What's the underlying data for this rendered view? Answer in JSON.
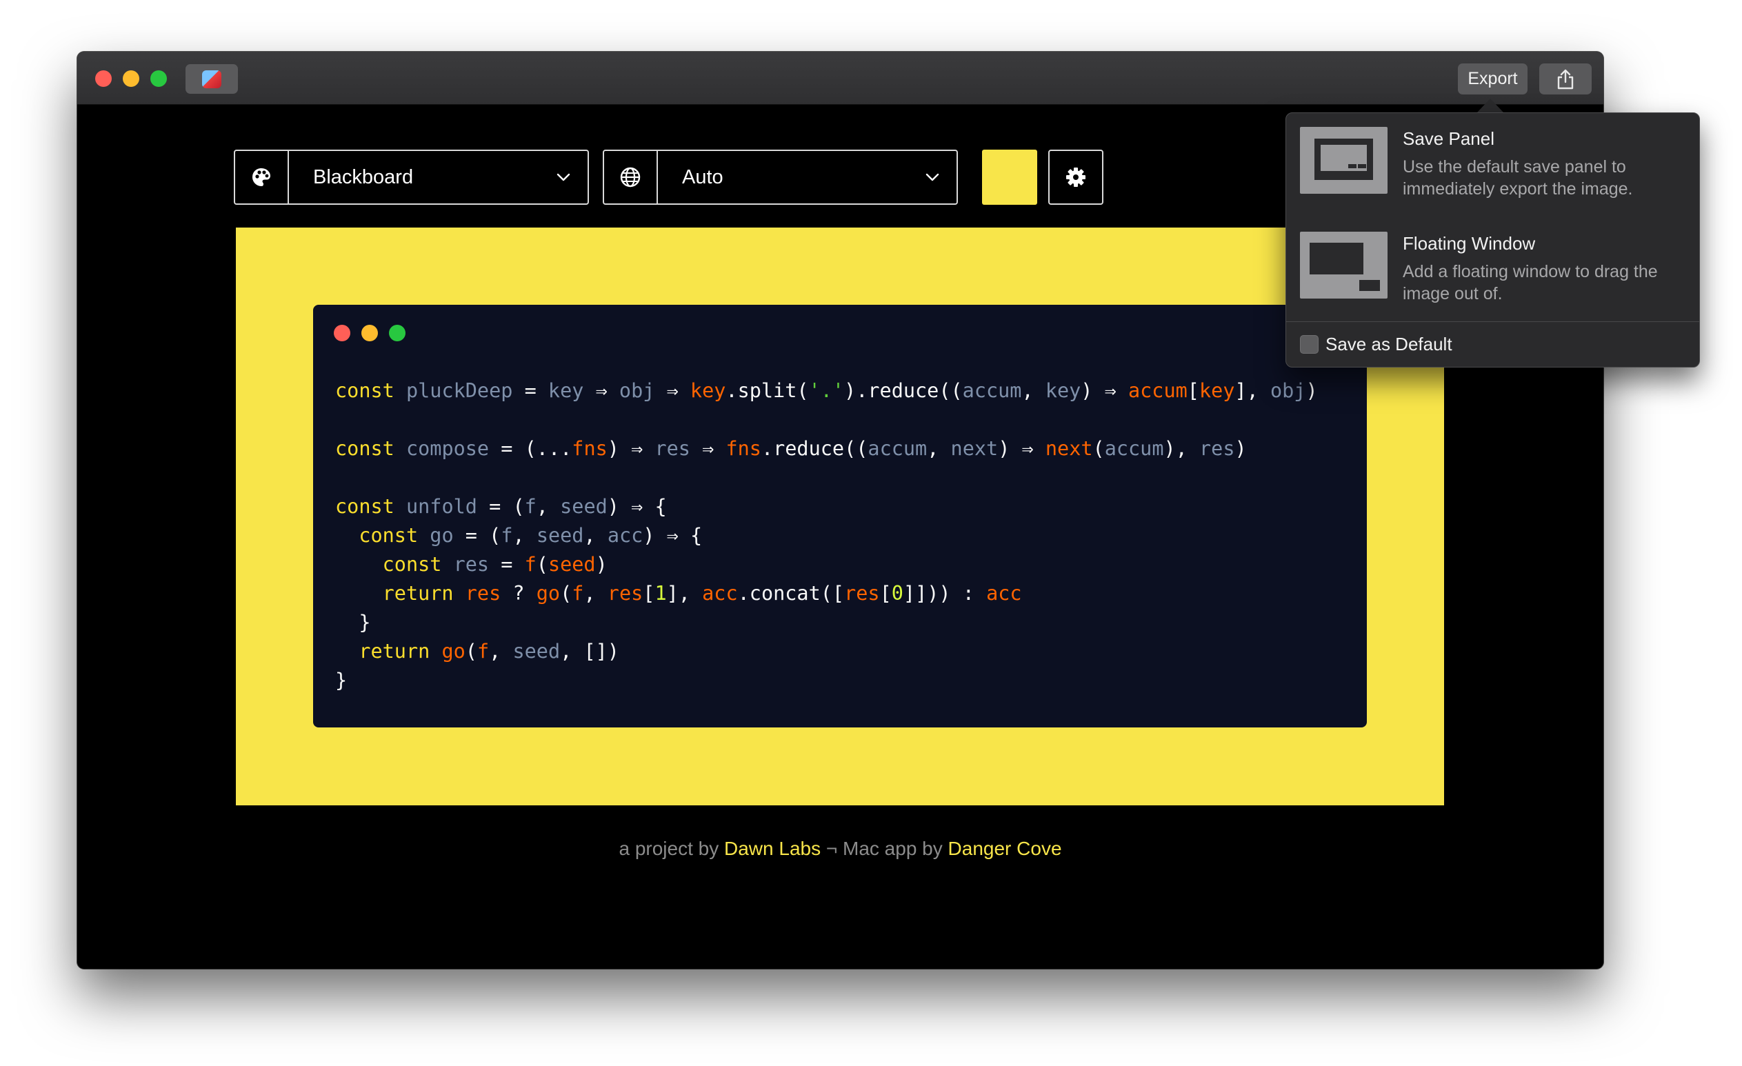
{
  "titlebar": {
    "app_icon": "carbon-app-icon",
    "export_label": "Export",
    "share_icon": "share-icon"
  },
  "toolbar": {
    "theme": {
      "icon": "palette-icon",
      "value": "Blackboard"
    },
    "language": {
      "icon": "globe-icon",
      "value": "Auto"
    },
    "background_color": "#f8e54a",
    "settings_icon": "gear-icon"
  },
  "editor": {
    "theme_name": "Blackboard",
    "code_lines": [
      "const pluckDeep = key ⇒ obj ⇒ key.split('.').reduce((accum, key) ⇒ accum[key], obj)",
      "",
      "const compose = (...fns) ⇒ res ⇒ fns.reduce((accum, next) ⇒ next(accum), res)",
      "",
      "const unfold = (f, seed) ⇒ {",
      "  const go = (f, seed, acc) ⇒ {",
      "    const res = f(seed)",
      "    return res ? go(f, res[1], acc.concat([res[0]])) : acc",
      "  }",
      "  return go(f, seed, [])",
      "}"
    ]
  },
  "footer": {
    "prefix": "a project by ",
    "link1": "Dawn Labs",
    "separator": " ¬ Mac app by ",
    "link2": "Danger Cove"
  },
  "export_menu": {
    "items": [
      {
        "title": "Save Panel",
        "description": "Use the default save panel to immediately export the image."
      },
      {
        "title": "Floating Window",
        "description": "Add a floating window to drag the image out of."
      }
    ],
    "save_default_label": "Save as Default",
    "save_default_checked": false
  },
  "colors": {
    "accent_yellow": "#f8e54a",
    "code_background": "#0c1022",
    "window_background": "#000000"
  }
}
